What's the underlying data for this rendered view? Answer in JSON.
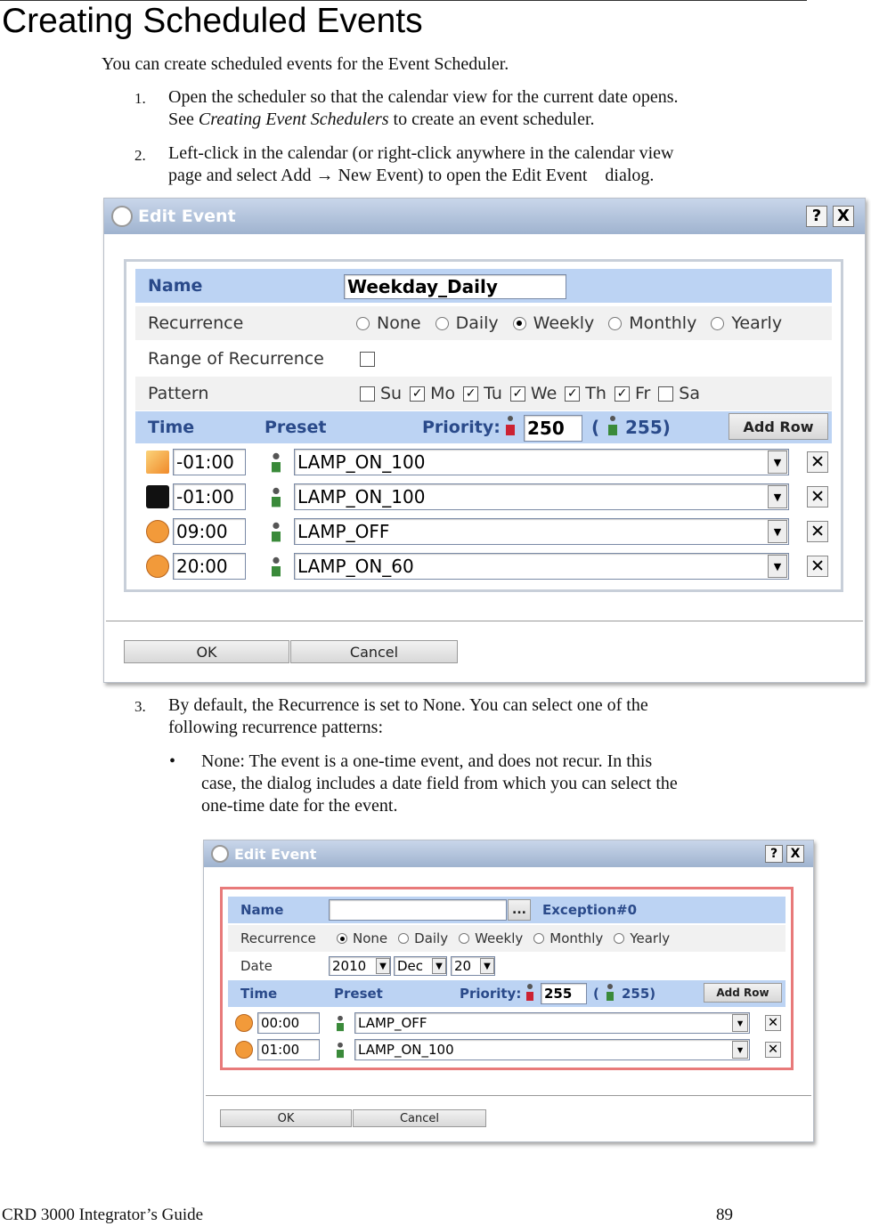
{
  "page": {
    "title": "Creating Scheduled Events",
    "intro": "You can create scheduled events for the Event Scheduler.",
    "steps": [
      {
        "num": "1.",
        "line1": "Open the scheduler so that the calendar view for the current date opens.",
        "line2_pre": "See ",
        "line2_italic": "Creating Event Schedulers",
        "line2_post": " to create an event scheduler."
      },
      {
        "num": "2.",
        "line1": "Left-click in the calendar (or right-click anywhere in the calendar view",
        "line2": "page and select Add → New Event) to open the Edit Event    dialog."
      },
      {
        "num": "3.",
        "line1": "By default, the Recurrence is set to None. You can select one of the",
        "line2": "following recurrence patterns:"
      }
    ],
    "bullet": {
      "symbol": "•",
      "line1": "None: The event is a one-time event, and does not recur. In this",
      "line2": "case, the dialog includes a date field from which you can select the",
      "line3": "one-time date for the event."
    },
    "footer_left": "CRD 3000 Integrator’s Guide",
    "footer_right": "89"
  },
  "dialog1": {
    "title": "Edit Event",
    "help": "?",
    "close": "X",
    "name_label": "Name",
    "name_value": "Weekday_Daily",
    "recurrence_label": "Recurrence",
    "recurrence_options": [
      "None",
      "Daily",
      "Weekly",
      "Monthly",
      "Yearly"
    ],
    "recurrence_selected": "Weekly",
    "range_label": "Range of Recurrence",
    "pattern_label": "Pattern",
    "days": [
      {
        "label": "Su",
        "checked": false
      },
      {
        "label": "Mo",
        "checked": true
      },
      {
        "label": "Tu",
        "checked": true
      },
      {
        "label": "We",
        "checked": true
      },
      {
        "label": "Th",
        "checked": true
      },
      {
        "label": "Fr",
        "checked": true
      },
      {
        "label": "Sa",
        "checked": false
      }
    ],
    "time_label": "Time",
    "preset_label": "Preset",
    "priority_label": "Priority:",
    "priority_value": "250",
    "priority_max_open": "(",
    "priority_max": "255)",
    "add_row": "Add Row",
    "rows": [
      {
        "icon": "sunrise-icon",
        "time": "-01:00",
        "preset": "LAMP_ON_100"
      },
      {
        "icon": "moon-icon",
        "time": "-01:00",
        "preset": "LAMP_ON_100"
      },
      {
        "icon": "clock-icon",
        "time": "09:00",
        "preset": "LAMP_OFF"
      },
      {
        "icon": "clock-icon",
        "time": "20:00",
        "preset": "LAMP_ON_60"
      }
    ],
    "ok": "OK",
    "cancel": "Cancel"
  },
  "dialog2": {
    "title": "Edit Event",
    "help": "?",
    "close": "X",
    "name_label": "Name",
    "name_value": "",
    "browse": "...",
    "exception": "Exception#0",
    "recurrence_label": "Recurrence",
    "recurrence_options": [
      "None",
      "Daily",
      "Weekly",
      "Monthly",
      "Yearly"
    ],
    "recurrence_selected": "None",
    "date_label": "Date",
    "year": "2010",
    "month": "Dec",
    "day": "20",
    "time_label": "Time",
    "preset_label": "Preset",
    "priority_label": "Priority:",
    "priority_value": "255",
    "priority_max_open": "(",
    "priority_max": "255)",
    "add_row": "Add Row",
    "rows": [
      {
        "icon": "clock-icon",
        "time": "00:00",
        "preset": "LAMP_OFF"
      },
      {
        "icon": "clock-icon",
        "time": "01:00",
        "preset": "LAMP_ON_100"
      }
    ],
    "ok": "OK",
    "cancel": "Cancel",
    "highlight_color": "#e87a7a"
  }
}
